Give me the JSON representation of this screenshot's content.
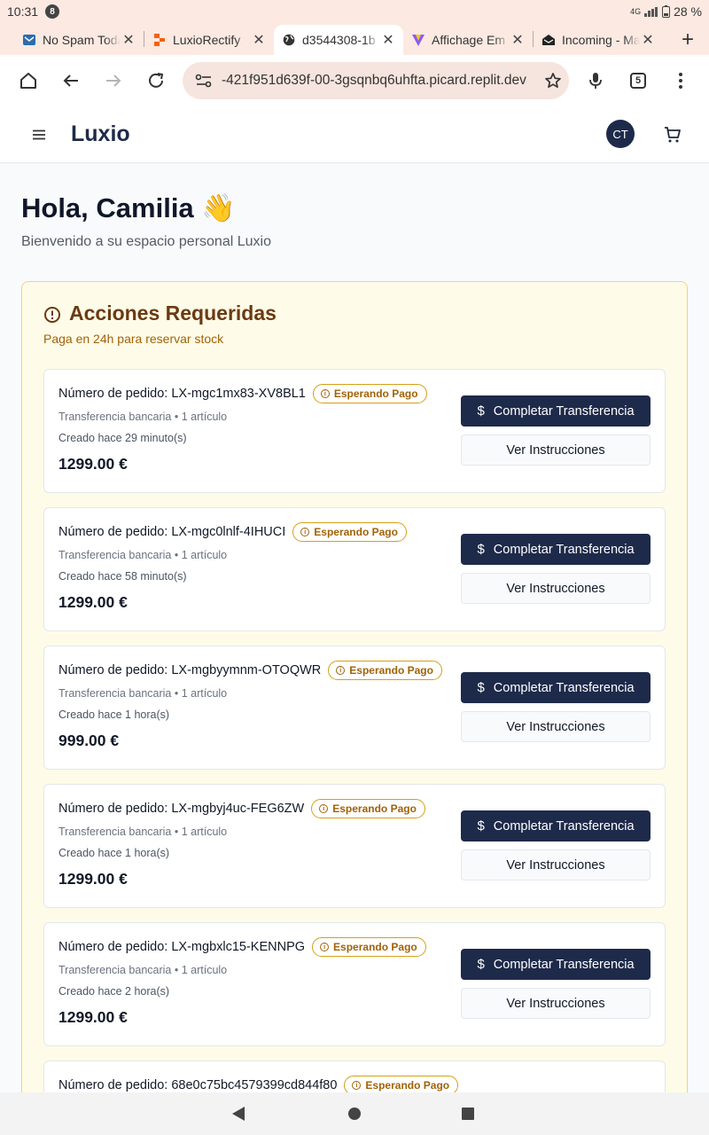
{
  "status_bar": {
    "time": "10:31",
    "notif_badge": "8",
    "network": "4G",
    "battery": "28 %"
  },
  "tabs": [
    {
      "title": "No Spam Today",
      "favicon": "mail-icon",
      "active": false
    },
    {
      "title": "LuxioRectify",
      "favicon": "replit-icon",
      "active": false
    },
    {
      "title": "d3544308-1b",
      "favicon": "globe-icon",
      "active": true
    },
    {
      "title": "Affichage Em",
      "favicon": "vite-icon",
      "active": false
    },
    {
      "title": "Incoming - Mail",
      "favicon": "inbox-icon",
      "active": false
    }
  ],
  "toolbar": {
    "url": "-421f951d639f-00-3gsqnbq6uhfta.picard.replit.dev",
    "tab_count": "5"
  },
  "app": {
    "brand": "Luxio",
    "avatar_initials": "CT"
  },
  "greeting": {
    "title": "Hola, Camilia 👋",
    "subtitle": "Bienvenido a su espacio personal Luxio"
  },
  "actions": {
    "title": "Acciones Requeridas",
    "subtitle": "Paga en 24h para reservar stock",
    "orders": [
      {
        "label": "Número de pedido: LX-mgc1mx83-XV8BL1",
        "badge": "Esperando Pago",
        "method": "Transferencia bancaria • 1 artículo",
        "created": "Creado hace 29 minuto(s)",
        "amount": "1299.00 €",
        "primary": "Completar Transferencia",
        "secondary": "Ver Instrucciones"
      },
      {
        "label": "Número de pedido: LX-mgc0lnlf-4IHUCI",
        "badge": "Esperando Pago",
        "method": "Transferencia bancaria • 1 artículo",
        "created": "Creado hace 58 minuto(s)",
        "amount": "1299.00 €",
        "primary": "Completar Transferencia",
        "secondary": "Ver Instrucciones"
      },
      {
        "label": "Número de pedido: LX-mgbyymnm-OTOQWR",
        "badge": "Esperando Pago",
        "method": "Transferencia bancaria • 1 artículo",
        "created": "Creado hace 1 hora(s)",
        "amount": "999.00 €",
        "primary": "Completar Transferencia",
        "secondary": "Ver Instrucciones"
      },
      {
        "label": "Número de pedido: LX-mgbyj4uc-FEG6ZW",
        "badge": "Esperando Pago",
        "method": "Transferencia bancaria • 1 artículo",
        "created": "Creado hace 1 hora(s)",
        "amount": "1299.00 €",
        "primary": "Completar Transferencia",
        "secondary": "Ver Instrucciones"
      },
      {
        "label": "Número de pedido: LX-mgbxlc15-KENNPG",
        "badge": "Esperando Pago",
        "method": "Transferencia bancaria • 1 artículo",
        "created": "Creado hace 2 hora(s)",
        "amount": "1299.00 €",
        "primary": "Completar Transferencia",
        "secondary": "Ver Instrucciones"
      },
      {
        "label": "Número de pedido: 68e0c75bc4579399cd844f80",
        "badge": "Esperando Pago",
        "method": "",
        "created": "",
        "amount": "",
        "primary": "",
        "secondary": ""
      }
    ]
  },
  "colors": {
    "navy": "#1e2a4a",
    "warning_bg": "#fefce8",
    "warning_border": "#f5d27a",
    "warning_text": "#a16207",
    "title_brown": "#6b3a12"
  }
}
